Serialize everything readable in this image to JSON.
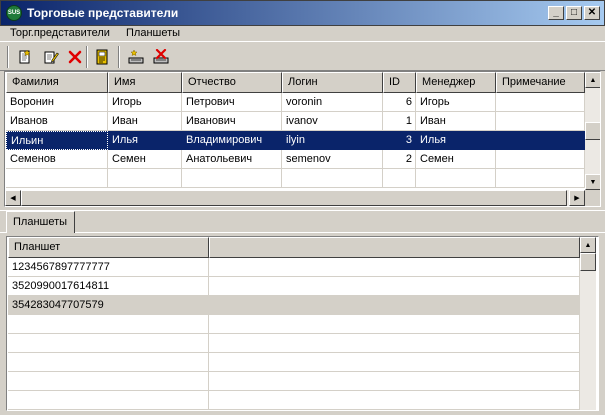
{
  "window": {
    "title": "Торговые представители",
    "app_icon_text": "SUS",
    "buttons": {
      "minimize": "_",
      "maximize": "□",
      "close": "✕"
    }
  },
  "menu": [
    "Торг.представители",
    "Планшеты"
  ],
  "toolbar": [
    "add-icon",
    "edit-icon",
    "delete-icon",
    "details-icon",
    "add-tablet-icon",
    "remove-tablet-icon"
  ],
  "reps_table": {
    "columns": [
      "Фамилия",
      "Имя",
      "Отчество",
      "Логин",
      "ID",
      "Менеджер",
      "Примечание"
    ],
    "rows": [
      [
        "Воронин",
        "Игорь",
        "Петрович",
        "voronin",
        "6",
        "Игорь",
        ""
      ],
      [
        "Иванов",
        "Иван",
        "Иванович",
        "ivanov",
        "1",
        "Иван",
        ""
      ],
      [
        "Ильин",
        "Илья",
        "Владимирович",
        "ilyin",
        "3",
        "Илья",
        ""
      ],
      [
        "Семенов",
        "Семен",
        "Анатольевич",
        "semenov",
        "2",
        "Семен",
        ""
      ]
    ],
    "selected_row": 2
  },
  "tabs": {
    "tablets": "Планшеты"
  },
  "tablets_table": {
    "columns": [
      "Планшет",
      ""
    ],
    "rows": [
      [
        "1234567897777777",
        ""
      ],
      [
        "3520990017614811",
        ""
      ],
      [
        "354283047707579",
        ""
      ]
    ],
    "highlighted_row": 2
  },
  "colors": {
    "selection": "#0a246a",
    "titlebar_start": "#0a246a",
    "titlebar_end": "#a6caf0",
    "face": "#d4d0c8"
  }
}
